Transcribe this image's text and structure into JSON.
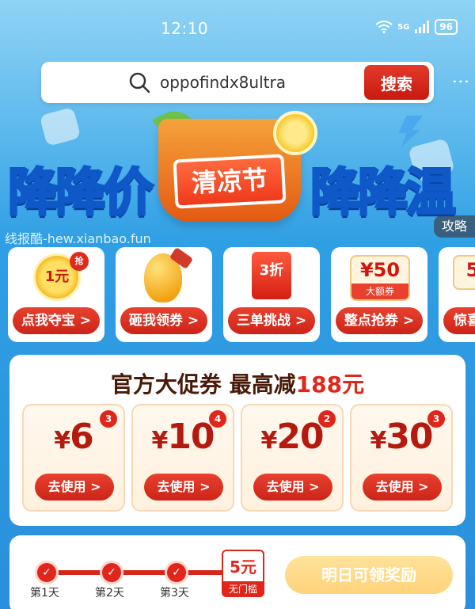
{
  "status_bar": {
    "time": "12:10",
    "network": "5G",
    "battery": "96"
  },
  "search": {
    "query": "oppofindx8ultra",
    "button_label": "搜索"
  },
  "banner": {
    "left_text": "降降价",
    "center_text": "清凉节",
    "right_text": "降降温",
    "strategy_label": "攻略",
    "watermark": "线报酷-hew.xianbao.fun"
  },
  "activities": [
    {
      "label": "点我夺宝 >",
      "icon": "coin-icon",
      "badge": "抢",
      "icon_text": "1元"
    },
    {
      "label": "砸我领券 >",
      "icon": "golden-egg-icon"
    },
    {
      "label": "三单挑战 >",
      "icon": "red-packet-icon",
      "icon_text": "3折"
    },
    {
      "label": "整点抢券 >",
      "icon": "coupon-icon",
      "icon_text": "¥50",
      "icon_sub": "大额券"
    },
    {
      "label": "惊喜",
      "icon": "ticket-icon",
      "icon_text": "5"
    }
  ],
  "coupons": {
    "title_prefix": "官方大促券 最高减",
    "title_highlight": "188元",
    "currency": "¥",
    "items": [
      {
        "amount": "6",
        "count": "3",
        "button": "去使用 >"
      },
      {
        "amount": "10",
        "count": "4",
        "button": "去使用 >"
      },
      {
        "amount": "20",
        "count": "2",
        "button": "去使用 >"
      },
      {
        "amount": "30",
        "count": "3",
        "button": "去使用 >"
      }
    ]
  },
  "signin": {
    "days": [
      "第1天",
      "第2天",
      "第3天"
    ],
    "check_symbol": "✓",
    "reward_amount": "5元",
    "reward_condition": "无门槛",
    "button_label": "明日可领奖励"
  },
  "colors": {
    "brand_red": "#e0261a",
    "sky_blue": "#2f9fe4",
    "coupon_text": "#b41a0f"
  }
}
